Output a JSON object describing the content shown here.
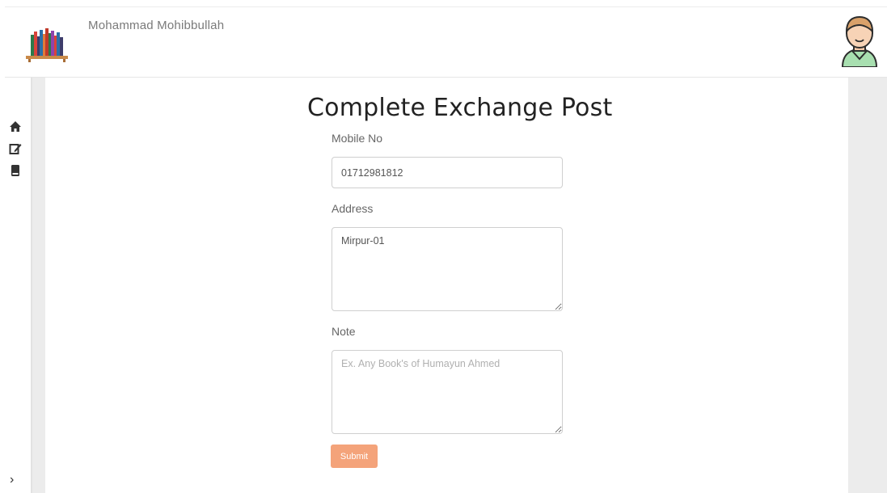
{
  "header": {
    "user_name": "Mohammad Mohibbullah"
  },
  "sidebar": {
    "items": [
      {
        "icon": "home-icon"
      },
      {
        "icon": "edit-icon"
      },
      {
        "icon": "book-icon"
      }
    ],
    "toggle_label": "›"
  },
  "form": {
    "title": "Complete Exchange Post",
    "mobile_label": "Mobile No",
    "mobile_value": "01712981812",
    "address_label": "Address",
    "address_value": "Mirpur-01",
    "note_label": "Note",
    "note_placeholder": "Ex. Any Book's of Humayun Ahmed",
    "note_value": "",
    "submit_label": "Submit"
  },
  "colors": {
    "accent": "#f4a37a",
    "background_gutter": "#ececec"
  }
}
